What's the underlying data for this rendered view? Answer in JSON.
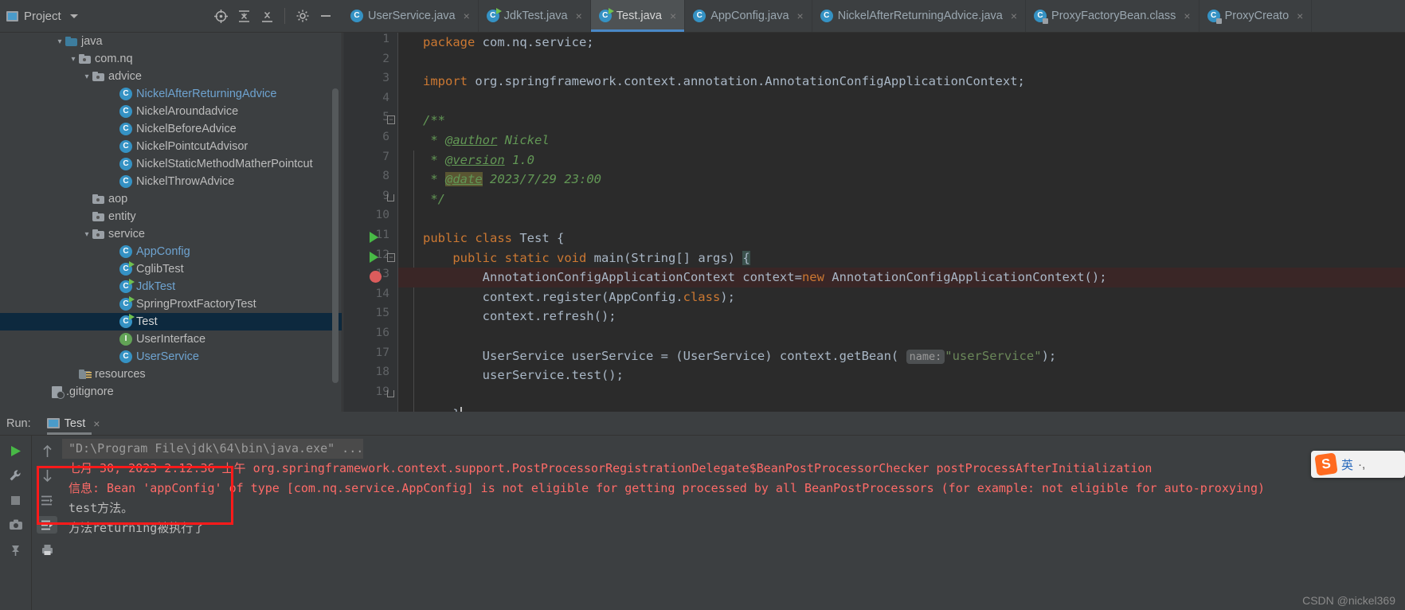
{
  "project_panel": {
    "title": "Project",
    "icons": [
      "target-icon",
      "collapse-all-icon",
      "expand-all-icon",
      "gear-icon",
      "minimize-icon"
    ],
    "tree": [
      {
        "label": "java",
        "indent": 4,
        "arrow": "v",
        "icon": "source-folder-icon",
        "style": "plain"
      },
      {
        "label": "com.nq",
        "indent": 5,
        "arrow": "v",
        "icon": "package-icon",
        "style": "plain"
      },
      {
        "label": "advice",
        "indent": 6,
        "arrow": "v",
        "icon": "package-icon",
        "style": "plain"
      },
      {
        "label": "NickelAfterReturningAdvice",
        "indent": 8,
        "arrow": "",
        "icon": "class-icon",
        "style": "blue"
      },
      {
        "label": "NickelAroundadvice",
        "indent": 8,
        "arrow": "",
        "icon": "class-icon",
        "style": "plain"
      },
      {
        "label": "NickelBeforeAdvice",
        "indent": 8,
        "arrow": "",
        "icon": "class-icon",
        "style": "plain"
      },
      {
        "label": "NickelPointcutAdvisor",
        "indent": 8,
        "arrow": "",
        "icon": "class-icon",
        "style": "plain"
      },
      {
        "label": "NickelStaticMethodMatherPointcut",
        "indent": 8,
        "arrow": "",
        "icon": "class-icon",
        "style": "plain"
      },
      {
        "label": "NickelThrowAdvice",
        "indent": 8,
        "arrow": "",
        "icon": "class-icon",
        "style": "plain"
      },
      {
        "label": "aop",
        "indent": 6,
        "arrow": "",
        "icon": "package-icon",
        "style": "plain"
      },
      {
        "label": "entity",
        "indent": 6,
        "arrow": "",
        "icon": "package-icon",
        "style": "plain"
      },
      {
        "label": "service",
        "indent": 6,
        "arrow": "v",
        "icon": "package-icon",
        "style": "plain"
      },
      {
        "label": "AppConfig",
        "indent": 8,
        "arrow": "",
        "icon": "class-icon",
        "style": "blue"
      },
      {
        "label": "CglibTest",
        "indent": 8,
        "arrow": "",
        "icon": "runnable-class-icon",
        "style": "plain"
      },
      {
        "label": "JdkTest",
        "indent": 8,
        "arrow": "",
        "icon": "runnable-class-icon",
        "style": "blue"
      },
      {
        "label": "SpringProxtFactoryTest",
        "indent": 8,
        "arrow": "",
        "icon": "runnable-class-icon",
        "style": "plain"
      },
      {
        "label": "Test",
        "indent": 8,
        "arrow": "",
        "icon": "runnable-class-icon",
        "style": "white",
        "selected": true
      },
      {
        "label": "UserInterface",
        "indent": 8,
        "arrow": "",
        "icon": "interface-icon",
        "style": "plain"
      },
      {
        "label": "UserService",
        "indent": 8,
        "arrow": "",
        "icon": "class-icon",
        "style": "blue"
      },
      {
        "label": "resources",
        "indent": 5,
        "arrow": "",
        "icon": "resource-folder-icon",
        "style": "plain"
      },
      {
        "label": ".gitignore",
        "indent": 3,
        "arrow": "",
        "icon": "gitignore-icon",
        "style": "plain"
      }
    ]
  },
  "editor_tabs": [
    {
      "label": "UserService.java",
      "icon": "class-icon",
      "active": false
    },
    {
      "label": "JdkTest.java",
      "icon": "runnable-class-icon",
      "active": false
    },
    {
      "label": "Test.java",
      "icon": "runnable-class-icon",
      "active": true
    },
    {
      "label": "AppConfig.java",
      "icon": "class-icon",
      "active": false
    },
    {
      "label": "NickelAfterReturningAdvice.java",
      "icon": "class-icon",
      "active": false
    },
    {
      "label": "ProxyFactoryBean.class",
      "icon": "class-file-icon",
      "active": false
    },
    {
      "label": "ProxyCreato",
      "icon": "class-file-icon",
      "active": false
    }
  ],
  "editor": {
    "lines": [
      {
        "n": 1,
        "mark": "",
        "fold": ""
      },
      {
        "n": 2,
        "mark": "",
        "fold": ""
      },
      {
        "n": 3,
        "mark": "",
        "fold": ""
      },
      {
        "n": 4,
        "mark": "",
        "fold": ""
      },
      {
        "n": 5,
        "mark": "",
        "fold": "box"
      },
      {
        "n": 6,
        "mark": "",
        "fold": ""
      },
      {
        "n": 7,
        "mark": "",
        "fold": ""
      },
      {
        "n": 8,
        "mark": "",
        "fold": ""
      },
      {
        "n": 9,
        "mark": "",
        "fold": "end"
      },
      {
        "n": 10,
        "mark": "",
        "fold": ""
      },
      {
        "n": 11,
        "mark": "run",
        "fold": ""
      },
      {
        "n": 12,
        "mark": "run",
        "fold": "box"
      },
      {
        "n": 13,
        "mark": "breakpoint",
        "fold": ""
      },
      {
        "n": 14,
        "mark": "",
        "fold": ""
      },
      {
        "n": 15,
        "mark": "",
        "fold": ""
      },
      {
        "n": 16,
        "mark": "",
        "fold": ""
      },
      {
        "n": 17,
        "mark": "",
        "fold": ""
      },
      {
        "n": 18,
        "mark": "",
        "fold": ""
      },
      {
        "n": 19,
        "mark": "",
        "fold": "end"
      }
    ],
    "code": {
      "l1_kw": "package",
      "l1_rest": " com.nq.service;",
      "l3_kw": "import",
      "l3_rest": " org.springframework.context.annotation.AnnotationConfigApplicationContext;",
      "l5": "/**",
      "l6_star": " * ",
      "l6_tag": "@author",
      "l6_rest": " Nickel",
      "l7_tag": "@version",
      "l7_rest": " 1.0",
      "l8_tag": "@date",
      "l8_rest": " 2023/7/29 23:00",
      "l9": " */",
      "l11_kw1": "public",
      "l11_kw2": "class",
      "l11_name": " Test {",
      "l12_kw1": "public",
      "l12_kw2": "static",
      "l12_kw3": "void",
      "l12_name": " main",
      "l12_args": "(String[] args) ",
      "l12_brace": "{",
      "l13_type": "AnnotationConfigApplicationContext context=",
      "l13_kw": "new",
      "l13_rest": " AnnotationConfigApplicationContext();",
      "l14": "context.register(AppConfig.",
      "l14_kw": "class",
      "l14_end": ");",
      "l15": "context.refresh();",
      "l17_a": "UserService userService = (UserService) context.getBean(",
      "l17_hint": "name:",
      "l17_str": "\"userService\"",
      "l17_end": ");",
      "l18": "userService.test();",
      "l19": "}"
    }
  },
  "run_panel": {
    "label": "Run:",
    "tab_name": "Test",
    "close": "×",
    "left_icons": [
      "run-icon",
      "wrench-icon",
      "stop-icon",
      "camera-icon",
      "pin-icon"
    ],
    "left_icons2": [
      "scroll-up-icon",
      "scroll-down-icon",
      "soft-wrap-icon",
      "scroll-to-end-icon",
      "print-icon"
    ],
    "console": [
      {
        "text": "\"D:\\Program File\\jdk\\64\\bin\\java.exe\" ...",
        "style": "gray"
      },
      {
        "text": "七月 30, 2023 2:12:36 上午 org.springframework.context.support.PostProcessorRegistrationDelegate$BeanPostProcessorChecker postProcessAfterInitialization",
        "style": "red"
      },
      {
        "text": "信息: Bean 'appConfig' of type [com.nq.service.AppConfig] is not eligible for getting processed by all BeanPostProcessors (for example: not eligible for auto-proxying)",
        "style": "red"
      },
      {
        "text": "test方法。",
        "style": "out"
      },
      {
        "text": "方法returning被执行了",
        "style": "out"
      }
    ]
  },
  "ime": {
    "lang": "英",
    "extra": "·,"
  },
  "watermark": "CSDN @nickel369",
  "colors": {
    "accent": "#4a88c7",
    "selection": "#0d293e",
    "keyword": "#cc7832",
    "string": "#6a8759",
    "comment": "#629755",
    "error": "#ff6b68",
    "annotation_box": "#ff1a1a"
  }
}
